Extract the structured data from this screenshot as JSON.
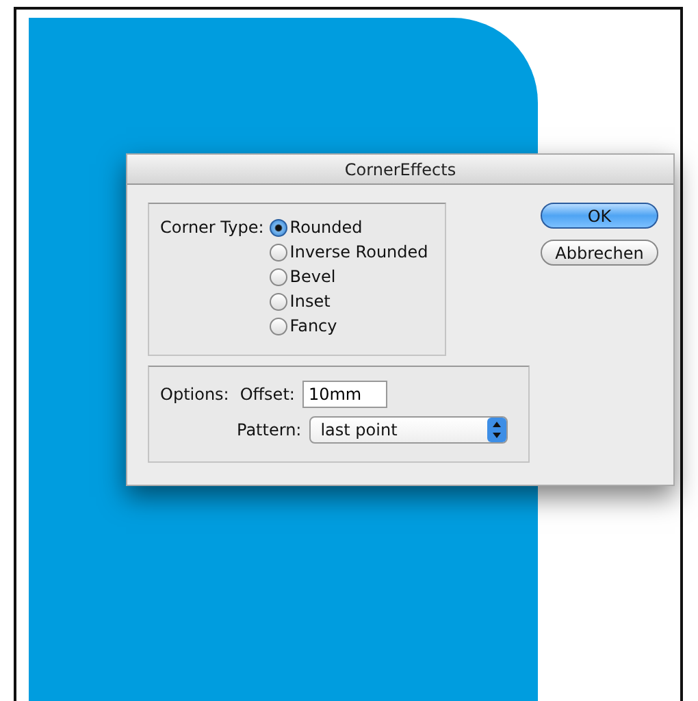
{
  "dialog": {
    "title": "CornerEffects",
    "corner_type": {
      "label": "Corner Type:",
      "options": [
        {
          "label": "Rounded",
          "selected": true
        },
        {
          "label": "Inverse Rounded",
          "selected": false
        },
        {
          "label": "Bevel",
          "selected": false
        },
        {
          "label": "Inset",
          "selected": false
        },
        {
          "label": "Fancy",
          "selected": false
        }
      ]
    },
    "options": {
      "label": "Options:",
      "offset_label": "Offset:",
      "offset_value": "10mm",
      "pattern_label": "Pattern:",
      "pattern_value": "last point"
    },
    "buttons": [
      {
        "label": "OK",
        "kind": "default"
      },
      {
        "label": "Abbrechen",
        "kind": "normal"
      }
    ]
  }
}
